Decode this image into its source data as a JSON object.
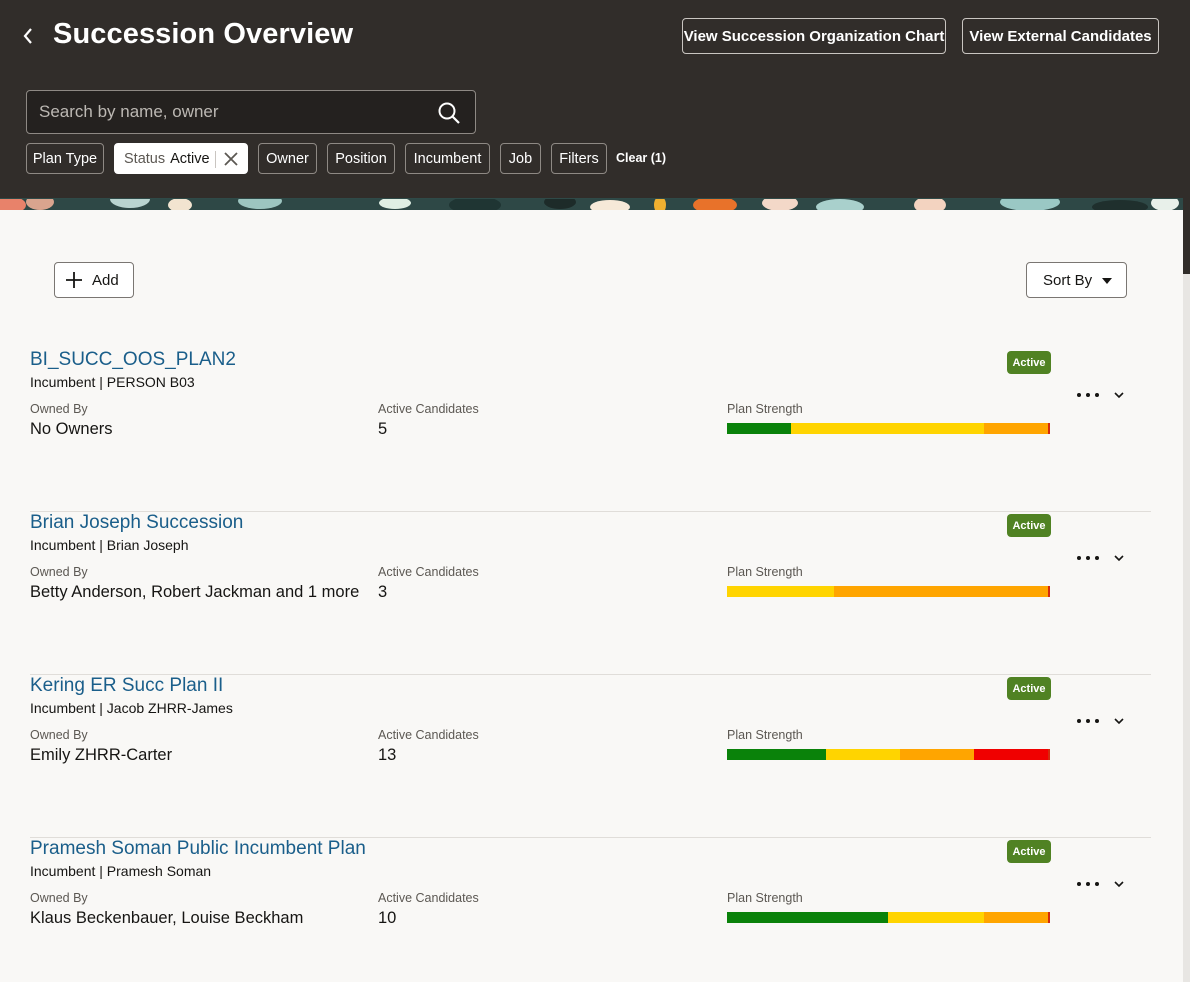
{
  "header": {
    "title": "Succession Overview",
    "buttons": {
      "org_chart": "View Succession Organization Chart",
      "external": "View External Candidates"
    },
    "search": {
      "placeholder": "Search by name, owner",
      "value": ""
    },
    "filters": {
      "plan_type": "Plan Type",
      "status_label": "Status",
      "status_value": "Active",
      "owner": "Owner",
      "position": "Position",
      "incumbent": "Incumbent",
      "job": "Job",
      "filters": "Filters",
      "clear": "Clear (1)"
    }
  },
  "toolbar": {
    "add_label": "Add",
    "sort_label": "Sort By"
  },
  "labels": {
    "owned_by": "Owned By",
    "active_candidates": "Active Candidates",
    "plan_strength": "Plan Strength"
  },
  "colors": {
    "green": "#0a820a",
    "yellow": "#ffd400",
    "orange": "#ffa500",
    "red": "#f00000",
    "badge": "#508223",
    "link": "#1a5e8a"
  },
  "plans": [
    {
      "name": "BI_SUCC_OOS_PLAN2",
      "incumbent": "Incumbent | PERSON B03",
      "status": "Active",
      "owned_by": "No Owners",
      "active_candidates": "5",
      "strength": [
        0.2,
        0.6,
        0.2,
        0.0
      ]
    },
    {
      "name": "Brian Joseph Succession",
      "incumbent": "Incumbent | Brian Joseph",
      "status": "Active",
      "owned_by": "Betty Anderson, Robert Jackman and 1 more",
      "active_candidates": "3",
      "strength": [
        0.0,
        0.333,
        0.667,
        0.0
      ]
    },
    {
      "name": "Kering ER Succ Plan II",
      "incumbent": "Incumbent | Jacob ZHRR-James",
      "status": "Active",
      "owned_by": "Emily ZHRR-Carter",
      "active_candidates": "13",
      "strength": [
        0.308,
        0.231,
        0.231,
        0.231
      ]
    },
    {
      "name": "Pramesh Soman Public Incumbent Plan",
      "incumbent": "Incumbent | Pramesh Soman",
      "status": "Active",
      "owned_by": "Klaus Beckenbauer, Louise Beckham",
      "active_candidates": "10",
      "strength": [
        0.5,
        0.3,
        0.2,
        0.0
      ]
    }
  ]
}
